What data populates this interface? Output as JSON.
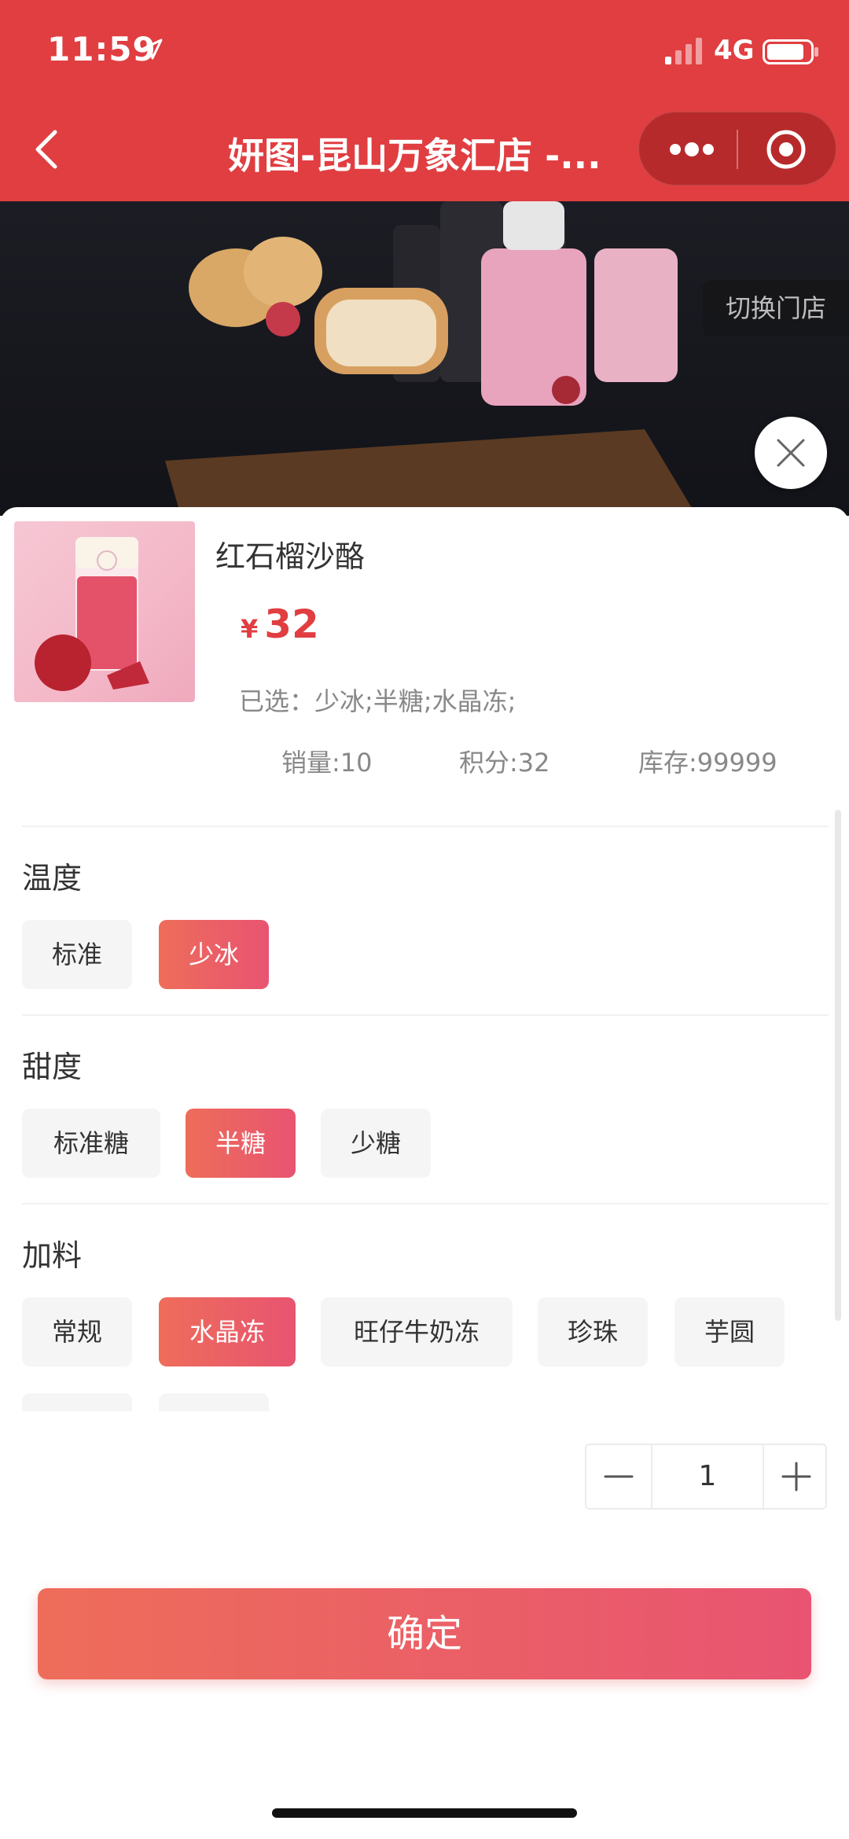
{
  "status_bar": {
    "time": "11:59",
    "network": "4G"
  },
  "nav": {
    "title": "妍图-昆山万象汇店 -..."
  },
  "hero": {
    "switch_store_label": "切换门店"
  },
  "product": {
    "name": "红石榴沙酪",
    "currency": "¥",
    "price": "32",
    "selected_label": "已选：",
    "selected_value": "少冰;半糖;水晶冻;",
    "sales": "销量:10",
    "points": "积分:32",
    "stock": "库存:99999"
  },
  "options": {
    "temperature": {
      "title": "温度",
      "items": [
        "标准",
        "少冰"
      ],
      "selected": "少冰"
    },
    "sweetness": {
      "title": "甜度",
      "items": [
        "标准糖",
        "半糖",
        "少糖"
      ],
      "selected": "半糖"
    },
    "toppings": {
      "title": "加料",
      "items": [
        "常规",
        "水晶冻",
        "旺仔牛奶冻",
        "珍珠",
        "芋圆"
      ],
      "selected": "水晶冻"
    }
  },
  "quantity": {
    "value": "1"
  },
  "confirm_label": "确定",
  "colors": {
    "brand_red": "#e03e41",
    "accent_gradient_start": "#ee6d5a",
    "accent_gradient_end": "#e85471"
  },
  "icons": [
    "location-arrow-icon",
    "signal-icon",
    "battery-icon",
    "back-icon",
    "more-icon",
    "record-icon",
    "close-icon",
    "minus-icon",
    "plus-icon"
  ]
}
